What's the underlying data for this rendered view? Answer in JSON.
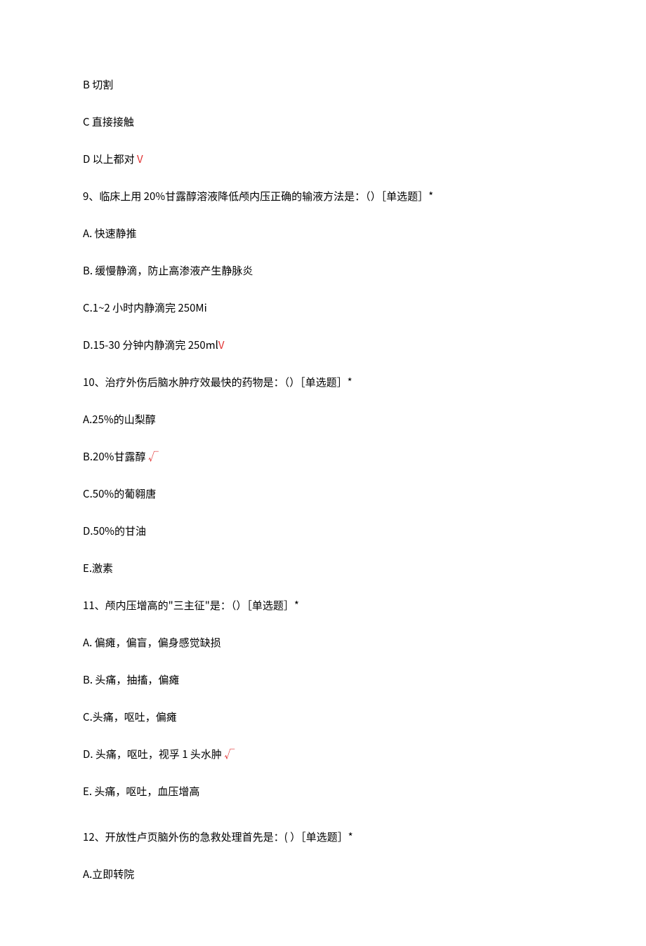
{
  "q8": {
    "optB": "B 切割",
    "optC": "C 直接接触",
    "optD_pre": "D 以上都对 ",
    "optD_mark": "V"
  },
  "q9": {
    "stem": "9、临床上用 20%甘露醇溶液降低颅内压正确的输液方法是：（）［单选题］*",
    "optA": "A. 快速静推",
    "optB": "B. 缓慢静滴，防止高渗液产生静脉炎",
    "optC": "C.1~2 小时内静滴完 250Mi",
    "optD_pre": "D.15-30 分钟内静滴完 250ml",
    "optD_mark": "V"
  },
  "q10": {
    "stem": "10、治疗外伤后脑水肿疗效最快的药物是：（）［单选题］*",
    "optA": "A.25%的山梨醇",
    "optB_pre": "B.20%甘露醇 ",
    "optB_mark": "√",
    "optC": "C.50%的葡翱唐",
    "optD": "D.50%的甘油",
    "optE": "E.激素"
  },
  "q11": {
    "stem": "11、颅内压增高的\"三主征\"是：（）［单选题］*",
    "optA": "A. 偏瘫，偏盲，偏身感觉缺损",
    "optB": "B. 头痛，抽搐，偏瘫",
    "optC": "C.头痛，呕吐，偏瘫",
    "optD_pre": "D. 头痛，呕吐，视孚 1 头水肿 ",
    "optD_mark": "√",
    "optE": "E. 头痛，呕吐，血压增高"
  },
  "q12": {
    "stem": "12、开放性卢页脑外伤的急救处理首先是：( ）［单选题］*",
    "optA": "A.立即转院"
  }
}
